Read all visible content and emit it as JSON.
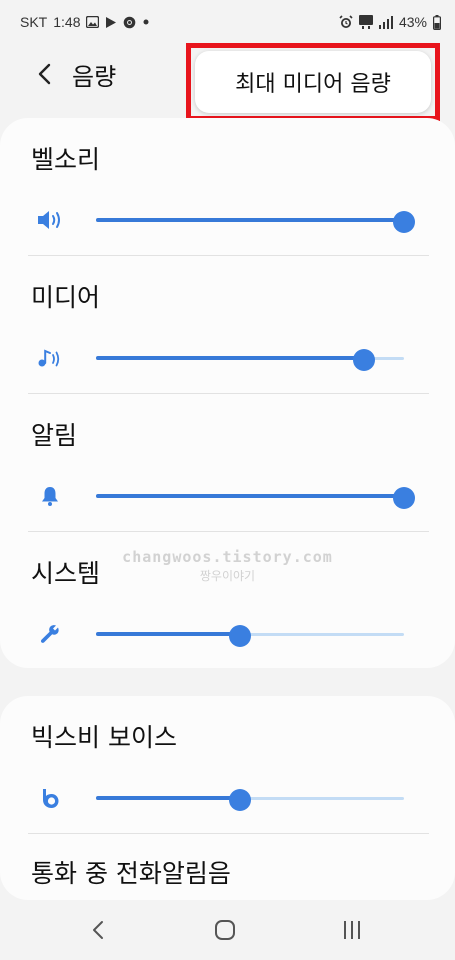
{
  "status_bar": {
    "carrier": "SKT",
    "time": "1:48",
    "battery": "43%",
    "left_icons": [
      "image-icon",
      "play-store-icon",
      "chrome-icon",
      "dot-icon"
    ],
    "right_icons": [
      "alarm-icon",
      "5g-icon",
      "signal-icon",
      "battery-icon"
    ]
  },
  "header": {
    "title": "음량"
  },
  "callout": {
    "label": "최대 미디어 음량"
  },
  "volume_items": [
    {
      "label": "벨소리",
      "icon": "speaker-icon",
      "level": 1.0
    },
    {
      "label": "미디어",
      "icon": "music-note-icon",
      "level": 0.87
    },
    {
      "label": "알림",
      "icon": "bell-icon",
      "level": 1.0
    },
    {
      "label": "시스템",
      "icon": "wrench-icon",
      "level": 0.467
    }
  ],
  "volume_items_2": [
    {
      "label": "빅스비 보이스",
      "icon": "bixby-icon",
      "level": 0.467
    },
    {
      "label": "통화 중 전화알림음"
    }
  ],
  "watermark": {
    "line1": "changwoos.tistory.com",
    "line2": "짱우이야기"
  },
  "nav": [
    "back-icon",
    "home-icon",
    "recents-icon"
  ],
  "colors": {
    "accent": "#3a7fe0",
    "track": "#c3dcf5",
    "callout_border": "#e8141c"
  }
}
